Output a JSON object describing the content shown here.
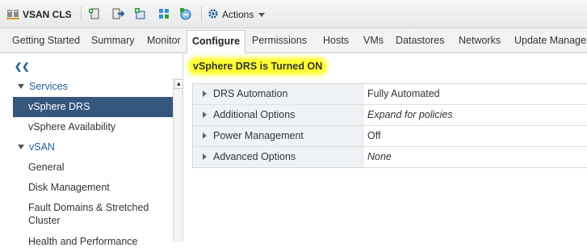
{
  "toolbar": {
    "title": "VSAN CLS",
    "actions_label": "Actions"
  },
  "tabs": [
    {
      "label": "Getting Started"
    },
    {
      "label": "Summary"
    },
    {
      "label": "Monitor"
    },
    {
      "label": "Configure",
      "active": true
    },
    {
      "label": "Permissions"
    },
    {
      "label": "Hosts"
    },
    {
      "label": "VMs"
    },
    {
      "label": "Datastores"
    },
    {
      "label": "Networks"
    },
    {
      "label": "Update Manager"
    }
  ],
  "nav": {
    "items": [
      {
        "label": "Services",
        "type": "group"
      },
      {
        "label": "vSphere DRS",
        "type": "sub",
        "selected": true
      },
      {
        "label": "vSphere Availability",
        "type": "sub"
      },
      {
        "label": "vSAN",
        "type": "group"
      },
      {
        "label": "General",
        "type": "sub"
      },
      {
        "label": "Disk Management",
        "type": "sub"
      },
      {
        "label": "Fault Domains & Stretched Cluster",
        "type": "sub"
      },
      {
        "label": "Health and Performance",
        "type": "sub"
      }
    ]
  },
  "main": {
    "headline": "vSphere DRS is Turned ON",
    "properties": [
      {
        "name": "DRS Automation",
        "value": "Fully Automated"
      },
      {
        "name": "Additional Options",
        "value": "Expand for policies",
        "italic": true
      },
      {
        "name": "Power Management",
        "value": "Off"
      },
      {
        "name": "Advanced Options",
        "value": "None",
        "italic": true
      }
    ]
  },
  "colors": {
    "selected_bg": "#35567d",
    "group_text": "#1f5d99",
    "headline_highlight": "#ffff33"
  }
}
